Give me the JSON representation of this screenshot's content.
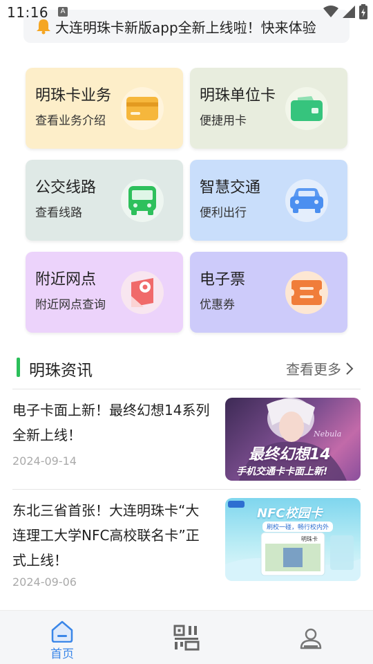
{
  "status_bar": {
    "time": "11:16",
    "notification_letter": "A"
  },
  "notice": {
    "text": "大连明珠卡新版app全新上线啦！快来体验"
  },
  "services": [
    {
      "title": "明珠卡业务",
      "subtitle": "查看业务介绍",
      "icon": "card-icon",
      "bg": "#fdeec9",
      "accent": "#f5b030"
    },
    {
      "title": "明珠单位卡",
      "subtitle": "便捷用卡",
      "icon": "wallet-icon",
      "bg": "#e8edde",
      "accent": "#33c27a"
    },
    {
      "title": "公交线路",
      "subtitle": "查看线路",
      "icon": "bus-icon",
      "bg": "#dfe9e6",
      "accent": "#2ec05c"
    },
    {
      "title": "智慧交通",
      "subtitle": "便利出行",
      "icon": "car-icon",
      "bg": "#c9defb",
      "accent": "#4b8ff0"
    },
    {
      "title": "附近网点",
      "subtitle": "附近网点查询",
      "icon": "map-pin-icon",
      "bg": "#ecd3fb",
      "accent": "#f06a6a"
    },
    {
      "title": "电子票",
      "subtitle": "优惠券",
      "icon": "ticket-icon",
      "bg": "#cdcbfa",
      "accent": "#f07d3a"
    }
  ],
  "news_section": {
    "title": "明珠资讯",
    "more": "查看更多"
  },
  "news": [
    {
      "title": "电子卡面上新！最终幻想14系列全新上线！",
      "date": "2024-09-14",
      "image_text_1": "Nebula",
      "image_text_2": "最终幻想14",
      "image_text_3": "手机交通卡卡面上新!"
    },
    {
      "title": "东北三省首张！大连明珠卡“大连理工大学NFC高校联名卡”正式上线！",
      "date": "2024-09-06",
      "image_text_1": "NFC校园卡",
      "image_text_2": "刷校一碰，畅行校内外",
      "image_text_3": "明珠卡"
    }
  ],
  "tabbar": {
    "home_label": "首页"
  },
  "colors": {
    "accent_green": "#2bbf5a",
    "tab_active": "#3a86e8"
  }
}
